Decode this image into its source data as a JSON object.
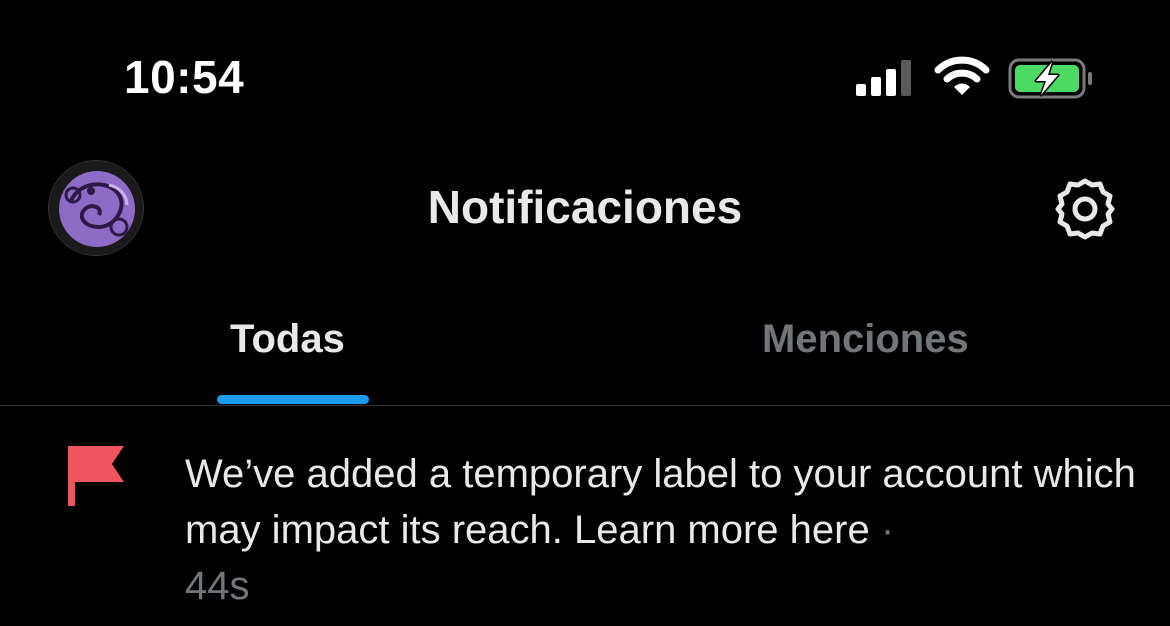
{
  "status_bar": {
    "time": "10:54",
    "icons": [
      "signal-icon",
      "wifi-icon",
      "battery-charging-icon"
    ],
    "battery_color": "#4cd964"
  },
  "header": {
    "title": "Notificaciones",
    "avatar_icon": "avatar",
    "settings_icon": "gear-icon"
  },
  "tabs": [
    {
      "label": "Todas",
      "selected": true
    },
    {
      "label": "Menciones",
      "selected": false
    }
  ],
  "notification": {
    "icon": "flag-icon",
    "icon_color": "#f4212e",
    "text": "We’ve added a temporary label to your account which may impact its reach. Learn more here",
    "separator": " · ",
    "time": "44s"
  },
  "colors": {
    "background": "#000000",
    "accent": "#1d9bf0",
    "primary_text": "#e7e9ea",
    "secondary_text": "#71767b"
  }
}
